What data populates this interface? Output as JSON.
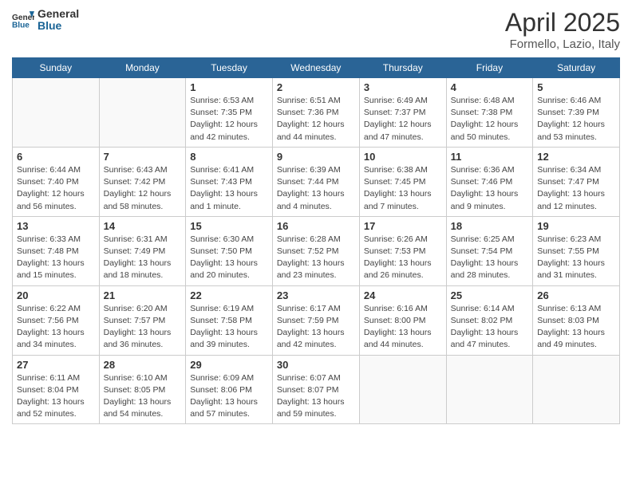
{
  "header": {
    "logo_general": "General",
    "logo_blue": "Blue",
    "month_title": "April 2025",
    "subtitle": "Formello, Lazio, Italy"
  },
  "weekdays": [
    "Sunday",
    "Monday",
    "Tuesday",
    "Wednesday",
    "Thursday",
    "Friday",
    "Saturday"
  ],
  "weeks": [
    [
      {
        "day": "",
        "info": ""
      },
      {
        "day": "",
        "info": ""
      },
      {
        "day": "1",
        "info": "Sunrise: 6:53 AM\nSunset: 7:35 PM\nDaylight: 12 hours and 42 minutes."
      },
      {
        "day": "2",
        "info": "Sunrise: 6:51 AM\nSunset: 7:36 PM\nDaylight: 12 hours and 44 minutes."
      },
      {
        "day": "3",
        "info": "Sunrise: 6:49 AM\nSunset: 7:37 PM\nDaylight: 12 hours and 47 minutes."
      },
      {
        "day": "4",
        "info": "Sunrise: 6:48 AM\nSunset: 7:38 PM\nDaylight: 12 hours and 50 minutes."
      },
      {
        "day": "5",
        "info": "Sunrise: 6:46 AM\nSunset: 7:39 PM\nDaylight: 12 hours and 53 minutes."
      }
    ],
    [
      {
        "day": "6",
        "info": "Sunrise: 6:44 AM\nSunset: 7:40 PM\nDaylight: 12 hours and 56 minutes."
      },
      {
        "day": "7",
        "info": "Sunrise: 6:43 AM\nSunset: 7:42 PM\nDaylight: 12 hours and 58 minutes."
      },
      {
        "day": "8",
        "info": "Sunrise: 6:41 AM\nSunset: 7:43 PM\nDaylight: 13 hours and 1 minute."
      },
      {
        "day": "9",
        "info": "Sunrise: 6:39 AM\nSunset: 7:44 PM\nDaylight: 13 hours and 4 minutes."
      },
      {
        "day": "10",
        "info": "Sunrise: 6:38 AM\nSunset: 7:45 PM\nDaylight: 13 hours and 7 minutes."
      },
      {
        "day": "11",
        "info": "Sunrise: 6:36 AM\nSunset: 7:46 PM\nDaylight: 13 hours and 9 minutes."
      },
      {
        "day": "12",
        "info": "Sunrise: 6:34 AM\nSunset: 7:47 PM\nDaylight: 13 hours and 12 minutes."
      }
    ],
    [
      {
        "day": "13",
        "info": "Sunrise: 6:33 AM\nSunset: 7:48 PM\nDaylight: 13 hours and 15 minutes."
      },
      {
        "day": "14",
        "info": "Sunrise: 6:31 AM\nSunset: 7:49 PM\nDaylight: 13 hours and 18 minutes."
      },
      {
        "day": "15",
        "info": "Sunrise: 6:30 AM\nSunset: 7:50 PM\nDaylight: 13 hours and 20 minutes."
      },
      {
        "day": "16",
        "info": "Sunrise: 6:28 AM\nSunset: 7:52 PM\nDaylight: 13 hours and 23 minutes."
      },
      {
        "day": "17",
        "info": "Sunrise: 6:26 AM\nSunset: 7:53 PM\nDaylight: 13 hours and 26 minutes."
      },
      {
        "day": "18",
        "info": "Sunrise: 6:25 AM\nSunset: 7:54 PM\nDaylight: 13 hours and 28 minutes."
      },
      {
        "day": "19",
        "info": "Sunrise: 6:23 AM\nSunset: 7:55 PM\nDaylight: 13 hours and 31 minutes."
      }
    ],
    [
      {
        "day": "20",
        "info": "Sunrise: 6:22 AM\nSunset: 7:56 PM\nDaylight: 13 hours and 34 minutes."
      },
      {
        "day": "21",
        "info": "Sunrise: 6:20 AM\nSunset: 7:57 PM\nDaylight: 13 hours and 36 minutes."
      },
      {
        "day": "22",
        "info": "Sunrise: 6:19 AM\nSunset: 7:58 PM\nDaylight: 13 hours and 39 minutes."
      },
      {
        "day": "23",
        "info": "Sunrise: 6:17 AM\nSunset: 7:59 PM\nDaylight: 13 hours and 42 minutes."
      },
      {
        "day": "24",
        "info": "Sunrise: 6:16 AM\nSunset: 8:00 PM\nDaylight: 13 hours and 44 minutes."
      },
      {
        "day": "25",
        "info": "Sunrise: 6:14 AM\nSunset: 8:02 PM\nDaylight: 13 hours and 47 minutes."
      },
      {
        "day": "26",
        "info": "Sunrise: 6:13 AM\nSunset: 8:03 PM\nDaylight: 13 hours and 49 minutes."
      }
    ],
    [
      {
        "day": "27",
        "info": "Sunrise: 6:11 AM\nSunset: 8:04 PM\nDaylight: 13 hours and 52 minutes."
      },
      {
        "day": "28",
        "info": "Sunrise: 6:10 AM\nSunset: 8:05 PM\nDaylight: 13 hours and 54 minutes."
      },
      {
        "day": "29",
        "info": "Sunrise: 6:09 AM\nSunset: 8:06 PM\nDaylight: 13 hours and 57 minutes."
      },
      {
        "day": "30",
        "info": "Sunrise: 6:07 AM\nSunset: 8:07 PM\nDaylight: 13 hours and 59 minutes."
      },
      {
        "day": "",
        "info": ""
      },
      {
        "day": "",
        "info": ""
      },
      {
        "day": "",
        "info": ""
      }
    ]
  ]
}
